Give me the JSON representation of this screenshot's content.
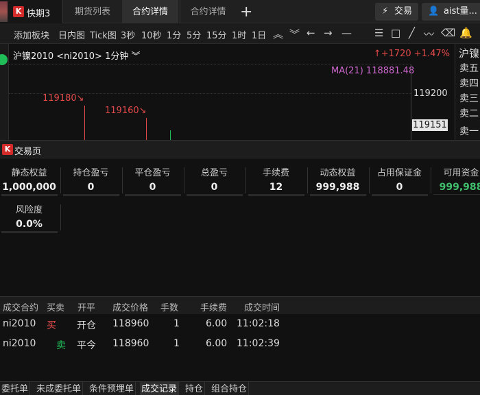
{
  "top": {
    "app_name": "快期3",
    "tabs": [
      "期货列表",
      "合约详情",
      "合约详情"
    ],
    "plus": "+",
    "trade_button": "交易",
    "user_button": "aist量..."
  },
  "toolbar": {
    "items": [
      "添加板块",
      "日内图",
      "Tick图",
      "3秒",
      "10秒",
      "1分",
      "5分",
      "15分",
      "1时",
      "1日"
    ],
    "tools": [
      "︽",
      "︾",
      "←",
      "→",
      "—",
      "☰",
      "□",
      "╱",
      "〰",
      "⌫",
      "🔔"
    ]
  },
  "chart": {
    "title": "沪镍2010 <ni2010> 1分钟 ︾",
    "change": "↑+1720 +1.47%",
    "ma_label": "MA(21) 118881.48",
    "tick_labels": [
      "119200"
    ],
    "last_price": "119151",
    "annotations": [
      "119180↘",
      "119160↘"
    ],
    "up_color": "#e34a4a",
    "down_color": "#1fbe58"
  },
  "orderbook": {
    "title": "沪镍",
    "rows": [
      "卖五",
      "卖四",
      "卖三",
      "卖二",
      "卖一"
    ]
  },
  "trade_panel": {
    "title": "交易页",
    "metrics": [
      {
        "label": "静态权益",
        "value": "1,000,000"
      },
      {
        "label": "持仓盈亏",
        "value": "0"
      },
      {
        "label": "平仓盈亏",
        "value": "0"
      },
      {
        "label": "总盈亏",
        "value": "0"
      },
      {
        "label": "手续费",
        "value": "12"
      },
      {
        "label": "动态权益",
        "value": "999,988"
      },
      {
        "label": "占用保证金",
        "value": "0"
      },
      {
        "label": "可用资金",
        "value": "999,988"
      },
      {
        "label": "风险度",
        "value": "0.0%"
      }
    ]
  },
  "trades": {
    "headers": [
      "成交合约",
      "买卖",
      "开平",
      "成交价格",
      "手数",
      "手续费",
      "成交时间"
    ],
    "rows": [
      [
        "ni2010",
        "买",
        "开仓",
        "118960",
        "1",
        "6.00",
        "11:02:18"
      ],
      [
        "ni2010",
        "卖",
        "平今",
        "118960",
        "1",
        "6.00",
        "11:02:39"
      ]
    ]
  },
  "bottom_tabs": [
    "委托单",
    "未成委托单",
    "条件预埋单",
    "成交记录",
    "持仓",
    "组合持仓"
  ]
}
